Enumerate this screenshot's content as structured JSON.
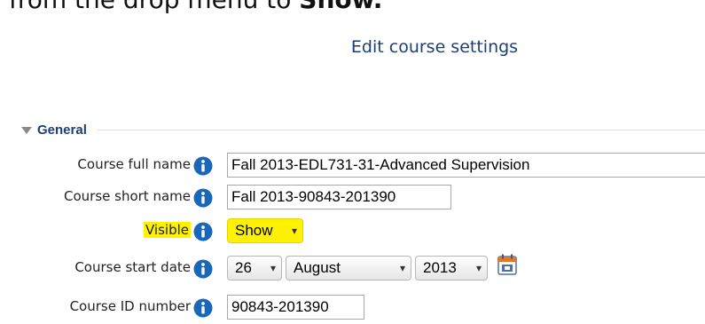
{
  "caption": {
    "prefix": "from the drop menu to ",
    "bold": "Show."
  },
  "page": {
    "title": "Edit course settings"
  },
  "section": {
    "title": "General"
  },
  "fields": {
    "fullname": {
      "label": "Course full name",
      "value": "Fall 2013-EDL731-31-Advanced Supervision"
    },
    "shortname": {
      "label": "Course short name",
      "value": "Fall 2013-90843-201390"
    },
    "visible": {
      "label": "Visible",
      "value": "Show"
    },
    "startdate": {
      "label": "Course start date",
      "day": "26",
      "month": "August",
      "year": "2013"
    },
    "idnumber": {
      "label": "Course ID number",
      "value": "90843-201390"
    }
  },
  "icons": {
    "help": "info-icon",
    "calendar": "calendar-icon"
  },
  "colors": {
    "highlight": "#fff200",
    "info_blue": "#1a66b8",
    "title_blue": "#1d3f74"
  }
}
